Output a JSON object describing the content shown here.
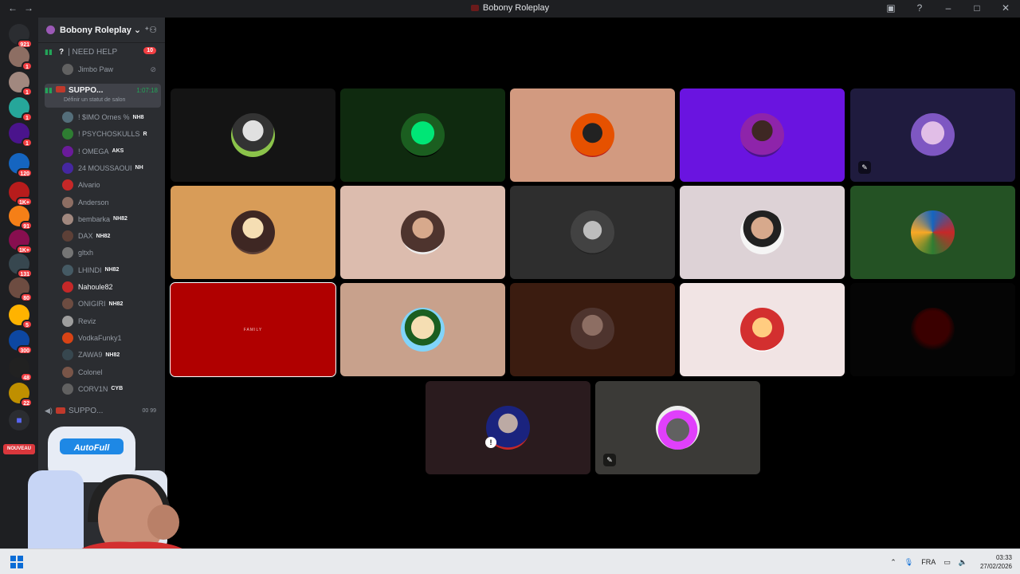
{
  "window": {
    "title": "Bobony Roleplay"
  },
  "server": {
    "name": "Bobony Roleplay"
  },
  "rail": {
    "badges": [
      "921",
      "1",
      "1",
      "1",
      "1",
      "120",
      "1K+",
      "91",
      "1K+",
      "131",
      "80",
      "5",
      "300",
      "48",
      "22"
    ],
    "new_label": "NOUVEAU"
  },
  "channels": {
    "need_help": {
      "label": "| NEED HELP",
      "count": "10"
    },
    "support_active": {
      "label": "SUPPO...",
      "timer": "1:07:18",
      "status": "Définir un statut de salon"
    },
    "support_2": {
      "label": "SUPPO...",
      "counts": "00  99"
    }
  },
  "need_help_users": [
    {
      "name": "Jimbo Paw"
    }
  ],
  "support_users": [
    {
      "name": "! $IMO Ornes %",
      "tag": "NH8"
    },
    {
      "name": "! PSYCHOSKULLS",
      "tag": "R"
    },
    {
      "name": "! OMEGA",
      "tag": "AKS"
    },
    {
      "name": "24 MOUSSAOUI",
      "tag": "NH"
    },
    {
      "name": "Alvario"
    },
    {
      "name": "Anderson"
    },
    {
      "name": "bembarka",
      "tag": "NH82"
    },
    {
      "name": "DAX",
      "tag": "NH82"
    },
    {
      "name": "gltxh"
    },
    {
      "name": "LHINDI",
      "tag": "NH82"
    },
    {
      "name": "Nahoule82"
    },
    {
      "name": "ONIGIRI",
      "tag": "NH82"
    },
    {
      "name": "Reviz"
    },
    {
      "name": "VodkaFunky1"
    },
    {
      "name": "ZAWA9",
      "tag": "NH82"
    },
    {
      "name": "Colonel"
    },
    {
      "name": "CORV1N",
      "tag": "CYB"
    }
  ],
  "tiles_caption": "FAMILY",
  "taskbar": {
    "lang": "FRA",
    "time": "03:33",
    "date": "27/02/2026"
  },
  "colors": {
    "accent": "#5865f2",
    "speaking": "#23a559",
    "danger": "#f23f43"
  }
}
